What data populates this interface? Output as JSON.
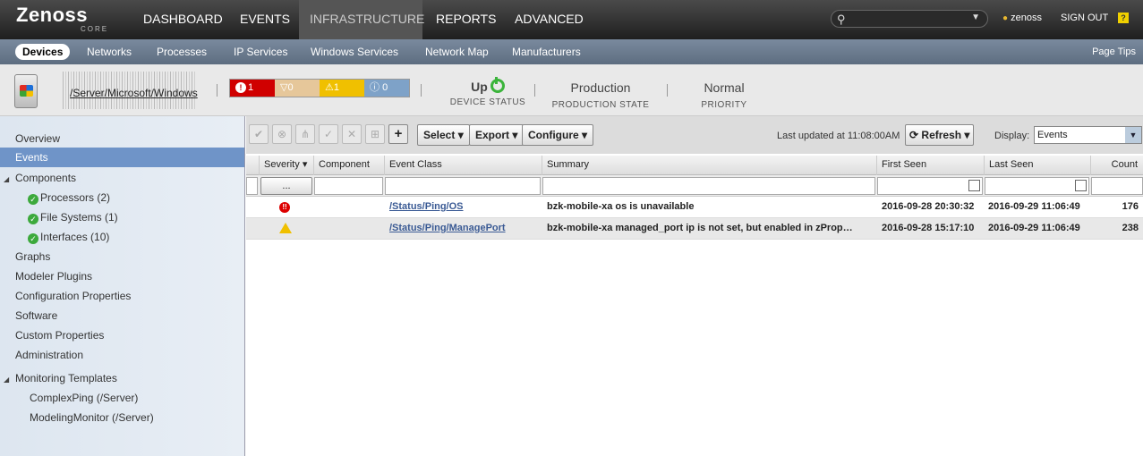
{
  "brand": {
    "name": "Zenoss",
    "sub": "CORE"
  },
  "nav": {
    "items": [
      "DASHBOARD",
      "EVENTS",
      "INFRASTRUCTURE",
      "REPORTS",
      "ADVANCED"
    ]
  },
  "user": {
    "name": "zenoss",
    "signout": "SIGN OUT",
    "help": "?"
  },
  "subnav": {
    "items": [
      "Devices",
      "Networks",
      "Processes",
      "IP Services",
      "Windows Services",
      "Network Map",
      "Manufacturers"
    ],
    "page_tips": "Page Tips"
  },
  "device": {
    "path": "/Server/Microsoft/Windows",
    "events": {
      "critical": "1",
      "error": "0",
      "warning": "1",
      "info": "0"
    },
    "status": {
      "value": "Up",
      "label": "DEVICE STATUS"
    },
    "production": {
      "value": "Production",
      "label": "PRODUCTION STATE"
    },
    "priority": {
      "value": "Normal",
      "label": "PRIORITY"
    }
  },
  "sidebar": {
    "overview": "Overview",
    "events": "Events",
    "components": "Components",
    "processors": "Processors (2)",
    "filesystems": "File Systems (1)",
    "interfaces": "Interfaces (10)",
    "graphs": "Graphs",
    "modeler": "Modeler Plugins",
    "config": "Configuration Properties",
    "software": "Software",
    "custom": "Custom Properties",
    "admin": "Administration",
    "templates": "Monitoring Templates",
    "tpl1": "ComplexPing (/Server)",
    "tpl2": "ModelingMonitor (/Server)"
  },
  "toolbar": {
    "select": "Select",
    "export": "Export",
    "configure": "Configure",
    "last_updated": "Last updated at 11:08:00AM",
    "refresh": "Refresh",
    "display_label": "Display:",
    "display_value": "Events",
    "severity_filter": "..."
  },
  "grid": {
    "headers": {
      "severity": "Severity",
      "component": "Component",
      "event_class": "Event Class",
      "summary": "Summary",
      "first_seen": "First Seen",
      "last_seen": "Last Seen",
      "count": "Count"
    },
    "rows": [
      {
        "severity": "critical",
        "event_class": "/Status/Ping/OS",
        "summary": "bzk-mobile-xa os is unavailable",
        "first_seen": "2016-09-28 20:30:32",
        "last_seen": "2016-09-29 11:06:49",
        "count": "176"
      },
      {
        "severity": "warning",
        "event_class": "/Status/Ping/ManagePort",
        "summary": "bzk-mobile-xa managed_port ip is not set, but enabled in zProp…",
        "first_seen": "2016-09-28 15:17:10",
        "last_seen": "2016-09-29 11:06:49",
        "count": "238"
      }
    ]
  },
  "colors": {
    "critical": "#d00000",
    "error": "#e8a44a",
    "warning": "#f0c000",
    "info": "#6e94c0",
    "selected": "#6f94c8"
  }
}
